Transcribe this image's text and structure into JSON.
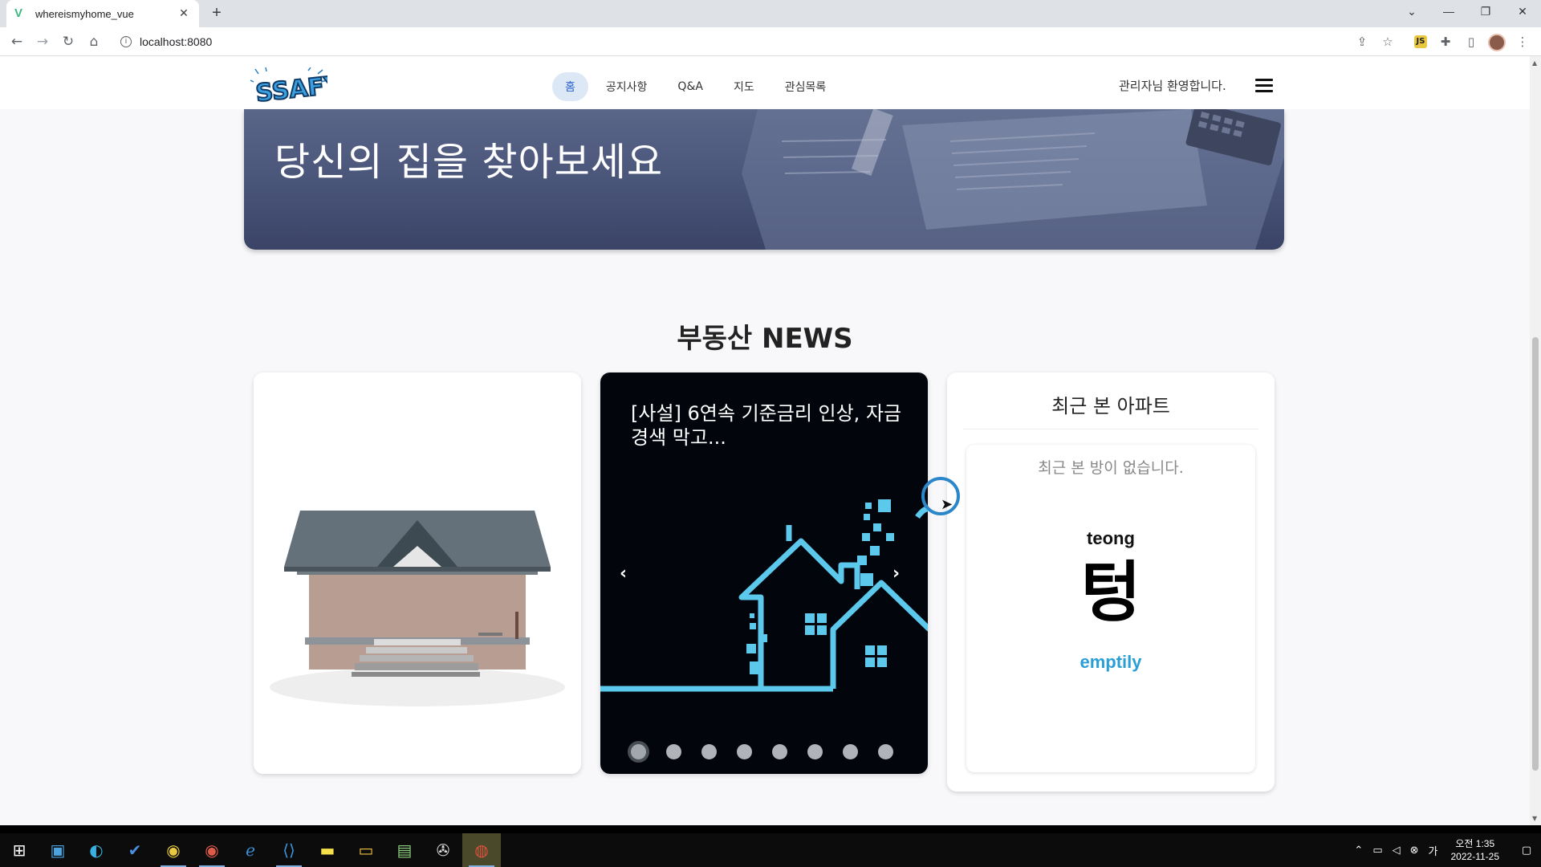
{
  "browser": {
    "tab_title": "whereismyhome_vue",
    "tab_close": "✕",
    "new_tab": "+",
    "url": "localhost:8080",
    "window_controls": [
      "⌄",
      "—",
      "❐",
      "✕"
    ]
  },
  "header": {
    "logo_text": "SSAFY",
    "nav": [
      {
        "label": "홈",
        "active": true
      },
      {
        "label": "공지사항"
      },
      {
        "label": "Q&A"
      },
      {
        "label": "지도"
      },
      {
        "label": "관심목록"
      }
    ],
    "welcome": "관리자님 환영합니다."
  },
  "hero": {
    "title": "당신의 집을 찾아보세요"
  },
  "news_section": {
    "title": "부동산 NEWS",
    "headline": "[사설] 6연속 기준금리 인상, 자금경색 막고...",
    "prev": "‹",
    "next": "›",
    "slide_count": 8,
    "active_slide": 1
  },
  "recent": {
    "title": "최근 본 아파트",
    "empty_message": "최근 본 방이 없습니다.",
    "illustration_top": "teong",
    "illustration_glyph": "텅",
    "illustration_bottom": "emptily"
  },
  "taskbar": {
    "clock_line1": "오전 1:35",
    "clock_line2": "2022-11-25"
  },
  "colors": {
    "accent": "#2a62c9",
    "nav_active_bg": "#dde8f7",
    "news_bg": "#02060c",
    "house_line": "#5bc8ec",
    "emptily": "#2a9fd6"
  }
}
